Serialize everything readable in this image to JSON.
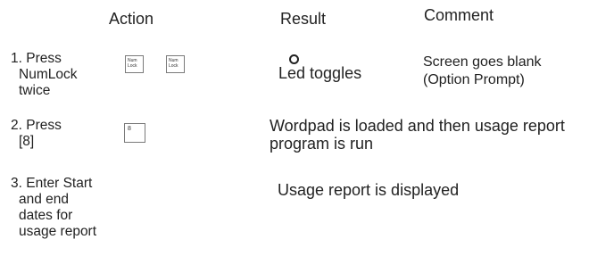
{
  "headers": {
    "action": "Action",
    "result": "Result",
    "comment": "Comment"
  },
  "rows": [
    {
      "action_lines": [
        "1. Press",
        "NumLock",
        "twice"
      ],
      "keys": [
        {
          "lines": [
            "Num",
            "Lock"
          ]
        },
        {
          "lines": [
            "Num",
            "Lock"
          ]
        }
      ],
      "result": "Led toggles",
      "comment_lines": [
        "Screen goes blank",
        "(Option Prompt)"
      ]
    },
    {
      "action_lines": [
        "2. Press",
        "[8]"
      ],
      "keys": [
        {
          "lines": [
            "8"
          ]
        }
      ],
      "result_lines": [
        "Wordpad is loaded and then usage report",
        "program is run"
      ]
    },
    {
      "action_lines": [
        "3. Enter Start",
        "and end",
        "dates for",
        "usage report"
      ],
      "result": "Usage report is displayed"
    }
  ]
}
